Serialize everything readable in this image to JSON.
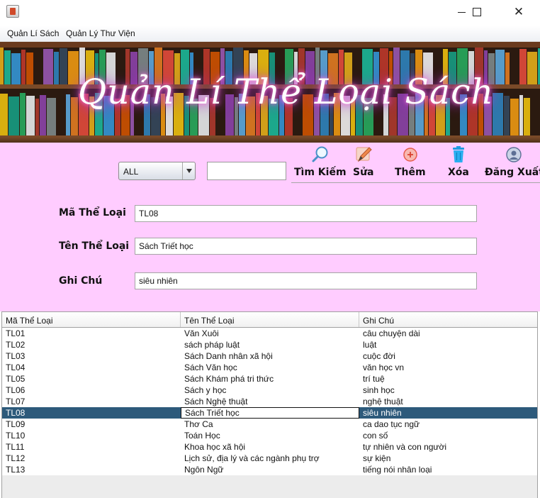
{
  "window": {
    "title": "",
    "controls": {
      "minimize_icon": "minimize-icon",
      "maximize_icon": "maximize-icon",
      "close_icon": "close-icon",
      "close_glyph": "✕"
    }
  },
  "menubar": {
    "items": [
      {
        "label": "Quản Lí Sách"
      },
      {
        "label": "Quản Lý Thư Viện"
      }
    ]
  },
  "banner": {
    "title": "Quản Lí Thể Loại Sách"
  },
  "search": {
    "filter_selected": "ALL",
    "query_value": ""
  },
  "toolbar": {
    "search_label": "Tìm Kiếm",
    "edit_label": "Sửa",
    "add_label": "Thêm",
    "delete_label": "Xóa",
    "logout_label": "Đăng Xuất"
  },
  "form": {
    "code_label": "Mã Thể Loại",
    "code_value": "TL08",
    "name_label": "Tên Thể Loại",
    "name_value": "Sách Triết học",
    "note_label": "Ghi Chú",
    "note_value": "siêu nhiên"
  },
  "table": {
    "headers": [
      "Mã Thể Loại",
      "Tên Thể Loại",
      "Ghi Chú"
    ],
    "selected_index": 7,
    "rows": [
      [
        "TL01",
        "Văn Xuôi",
        "câu chuyện dài"
      ],
      [
        "TL02",
        "sách pháp luật",
        "luật"
      ],
      [
        "TL03",
        "Sách Danh nhân xã hội",
        "cuộc đời"
      ],
      [
        "TL04",
        "Sách Văn học",
        "văn học vn"
      ],
      [
        "TL05",
        "Sách Khám phá tri thức",
        "trí tuệ"
      ],
      [
        "TL06",
        "Sách y học",
        "sinh học"
      ],
      [
        "TL07",
        "Sách Nghệ thuật",
        "nghệ thuật"
      ],
      [
        "TL08",
        "Sách Triết học",
        "siêu nhiên"
      ],
      [
        "TL09",
        "Thơ Ca",
        "ca dao tục ngữ"
      ],
      [
        "TL10",
        "Toán Học",
        "con số"
      ],
      [
        "TL11",
        "Khoa học xã hội",
        "tự nhiên và con người"
      ],
      [
        "TL12",
        " Lịch sử, địa lý và các ngành phụ trợ",
        "sự kiện"
      ],
      [
        "TL13",
        "Ngôn Ngữ",
        "tiếng nói nhân loại"
      ]
    ]
  },
  "colors": {
    "form_background": "#ffccff",
    "selection": "#2d5a7b",
    "banner_glow": "#c63bd6"
  }
}
